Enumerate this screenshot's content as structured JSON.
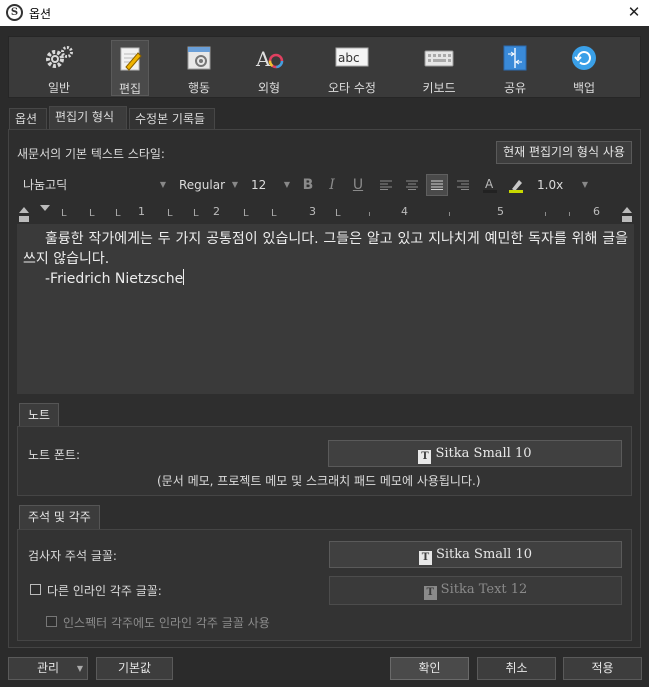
{
  "window": {
    "title": "옵션",
    "close_glyph": "✕"
  },
  "toolbar": {
    "items": [
      {
        "label": "일반",
        "icon": "gears-icon"
      },
      {
        "label": "편집",
        "icon": "edit-pencil-icon"
      },
      {
        "label": "행동",
        "icon": "behavior-icon"
      },
      {
        "label": "외형",
        "icon": "appearance-icon"
      },
      {
        "label": "오타 수정",
        "icon": "spellcheck-abc-icon"
      },
      {
        "label": "키보드",
        "icon": "keyboard-icon"
      },
      {
        "label": "공유",
        "icon": "sharing-icon"
      },
      {
        "label": "백업",
        "icon": "backup-icon"
      }
    ],
    "active": "편집"
  },
  "tabs": {
    "items": [
      "옵션",
      "편집기 형식",
      "수정본 기록들"
    ],
    "active": "편집기 형식"
  },
  "default_style": {
    "label": "새문서의 기본 텍스트 스타일:",
    "use_current_button": "현재 편집기의 형식 사용"
  },
  "format_bar": {
    "font_family": "나눔고딕",
    "font_style": "Regular",
    "font_size": "12",
    "bold": "B",
    "italic": "I",
    "underline": "U",
    "line_spacing": "1.0x"
  },
  "ruler": {
    "labels": [
      "1",
      "2",
      "3",
      "4",
      "5",
      "6"
    ]
  },
  "editor": {
    "paragraph1": "훌륭한 작가에게는 두 가지 공통점이 있습니다. 그들은 알고 있고 지나치게 예민한 독자를 위해 글을 쓰지 않습니다.",
    "paragraph2": "-Friedrich Nietzsche"
  },
  "notes": {
    "tab_label": "노트",
    "font_label": "노트 폰트:",
    "font_value": "Sitka Small 10",
    "hint": "(문서 메모, 프로젝트 메모 및 스크래치 패드 메모에 사용됩니다.)"
  },
  "comments": {
    "tab_label": "주석 및 각주",
    "inspector_label": "검사자 주석 글꼴:",
    "inspector_font": "Sitka Small 10",
    "inline_label": "다른 인라인 각주 글꼴:",
    "inline_font": "Sitka Text 12",
    "inspector_inline_label": "인스펙터 각주에도 인라인 각주 글꼴 사용"
  },
  "bottom": {
    "manage": "관리",
    "defaults": "기본값",
    "ok": "확인",
    "cancel": "취소",
    "apply": "적용"
  },
  "font_glyph": "T"
}
